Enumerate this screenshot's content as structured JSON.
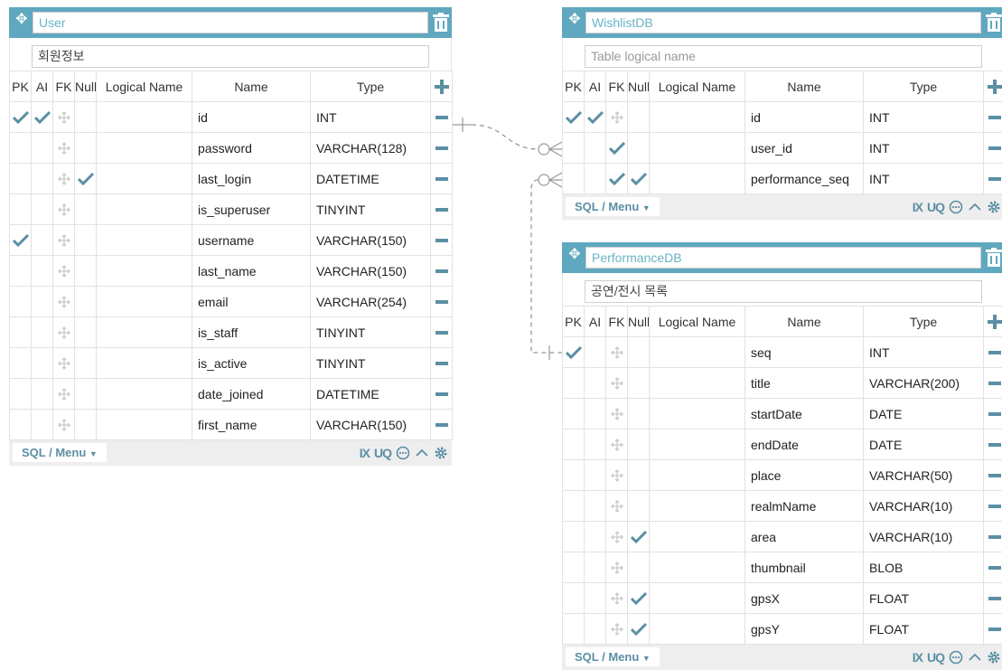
{
  "colors": {
    "header": "#5fa8bf",
    "accent": "#5b8fa4",
    "check": "#5b8fa4"
  },
  "column_headers": {
    "pk": "PK",
    "ai": "AI",
    "fk": "FK",
    "null": "Null",
    "logical": "Logical Name",
    "name": "Name",
    "type": "Type"
  },
  "footer": {
    "menu_label": "SQL / Menu",
    "ix": "IX",
    "uq": "UQ"
  },
  "tables": {
    "user": {
      "name": "User",
      "logical": "회원정보",
      "rows": [
        {
          "name": "id",
          "type": "INT",
          "pk": true,
          "ai": true,
          "fk": false,
          "null": false
        },
        {
          "name": "password",
          "type": "VARCHAR(128)",
          "pk": false,
          "ai": false,
          "fk": false,
          "null": false
        },
        {
          "name": "last_login",
          "type": "DATETIME",
          "pk": false,
          "ai": false,
          "fk": false,
          "null": true
        },
        {
          "name": "is_superuser",
          "type": "TINYINT",
          "pk": false,
          "ai": false,
          "fk": false,
          "null": false
        },
        {
          "name": "username",
          "type": "VARCHAR(150)",
          "pk": true,
          "ai": false,
          "fk": false,
          "null": false
        },
        {
          "name": "last_name",
          "type": "VARCHAR(150)",
          "pk": false,
          "ai": false,
          "fk": false,
          "null": false
        },
        {
          "name": "email",
          "type": "VARCHAR(254)",
          "pk": false,
          "ai": false,
          "fk": false,
          "null": false
        },
        {
          "name": "is_staff",
          "type": "TINYINT",
          "pk": false,
          "ai": false,
          "fk": false,
          "null": false
        },
        {
          "name": "is_active",
          "type": "TINYINT",
          "pk": false,
          "ai": false,
          "fk": false,
          "null": false
        },
        {
          "name": "date_joined",
          "type": "DATETIME",
          "pk": false,
          "ai": false,
          "fk": false,
          "null": false
        },
        {
          "name": "first_name",
          "type": "VARCHAR(150)",
          "pk": false,
          "ai": false,
          "fk": false,
          "null": false
        }
      ]
    },
    "wishlist": {
      "name": "WishlistDB",
      "logical_placeholder": "Table logical name",
      "rows": [
        {
          "name": "id",
          "type": "INT",
          "pk": true,
          "ai": true,
          "fk": false,
          "null": false
        },
        {
          "name": "user_id",
          "type": "INT",
          "pk": false,
          "ai": false,
          "fk": true,
          "null": false
        },
        {
          "name": "performance_seq",
          "type": "INT",
          "pk": false,
          "ai": false,
          "fk": true,
          "null": true
        }
      ]
    },
    "performance": {
      "name": "PerformanceDB",
      "logical": "공연/전시 목록",
      "rows": [
        {
          "name": "seq",
          "type": "INT",
          "pk": true,
          "ai": false,
          "fk": false,
          "null": false
        },
        {
          "name": "title",
          "type": "VARCHAR(200)",
          "pk": false,
          "ai": false,
          "fk": false,
          "null": false
        },
        {
          "name": "startDate",
          "type": "DATE",
          "pk": false,
          "ai": false,
          "fk": false,
          "null": false
        },
        {
          "name": "endDate",
          "type": "DATE",
          "pk": false,
          "ai": false,
          "fk": false,
          "null": false
        },
        {
          "name": "place",
          "type": "VARCHAR(50)",
          "pk": false,
          "ai": false,
          "fk": false,
          "null": false
        },
        {
          "name": "realmName",
          "type": "VARCHAR(10)",
          "pk": false,
          "ai": false,
          "fk": false,
          "null": false
        },
        {
          "name": "area",
          "type": "VARCHAR(10)",
          "pk": false,
          "ai": false,
          "fk": false,
          "null": true
        },
        {
          "name": "thumbnail",
          "type": "BLOB",
          "pk": false,
          "ai": false,
          "fk": false,
          "null": false
        },
        {
          "name": "gpsX",
          "type": "FLOAT",
          "pk": false,
          "ai": false,
          "fk": false,
          "null": true
        },
        {
          "name": "gpsY",
          "type": "FLOAT",
          "pk": false,
          "ai": false,
          "fk": false,
          "null": true
        }
      ]
    }
  }
}
